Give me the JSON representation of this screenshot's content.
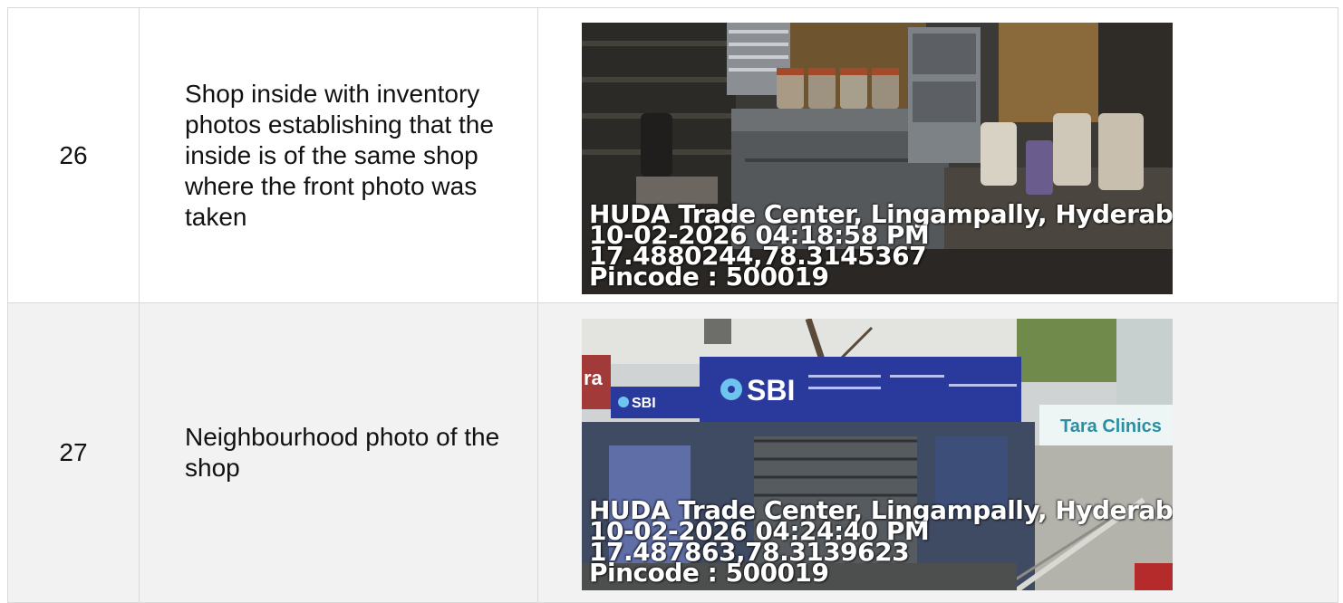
{
  "rows": [
    {
      "number": "26",
      "description": "Shop inside with inventory photos establishing that the inside is of the same shop where the front photo was taken",
      "photo": {
        "location": "HUDA Trade Center, Lingampally, Hyderabad",
        "datetime": "10-02-2026 04:18:58 PM",
        "coordinates": "17.4880244,78.3145367",
        "pincode": "Pincode : 500019"
      }
    },
    {
      "number": "27",
      "description": "Neighbourhood photo of the shop",
      "photo": {
        "location": "HUDA Trade Center, Lingampally, Hyderabad",
        "datetime": "10-02-2026 04:24:40 PM",
        "coordinates": "17.487863,78.3139623",
        "pincode": "Pincode : 500019",
        "signage": {
          "bank_logo": "SBI",
          "bank_logo_small": "SBI",
          "clinic_sign": "Tara Clinics",
          "side_sign": "ra"
        }
      }
    }
  ],
  "colors": {
    "border": "#d9d9d9",
    "row_alt_background": "#f2f2f2",
    "sbi_blue": "#2a3a9c",
    "stamp_text": "#ffffff"
  }
}
